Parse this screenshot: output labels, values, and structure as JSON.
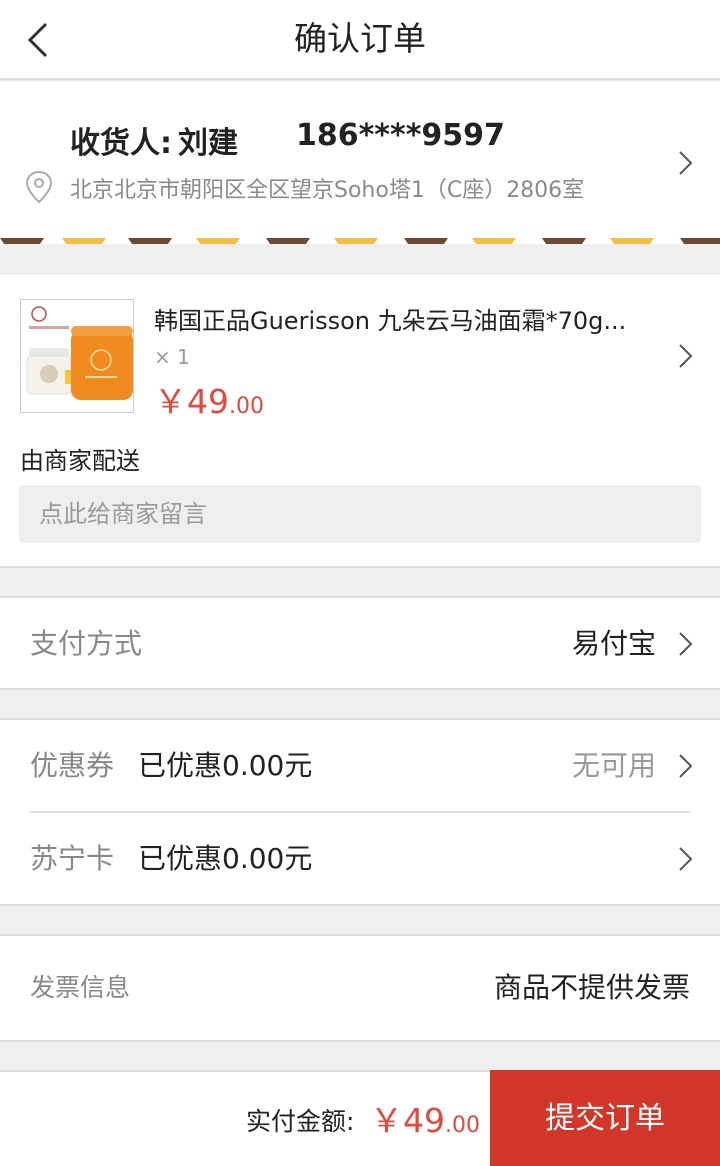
{
  "nav": {
    "title": "确认订单"
  },
  "address": {
    "recipient_label": "收货人:",
    "recipient_name": "刘建",
    "phone": "186****9597",
    "full_address": "北京北京市朝阳区全区望京Soho塔1（C座）2806室"
  },
  "product": {
    "name": "韩国正品Guerisson 九朵云马油面霜*70g...",
    "quantity": "× 1",
    "price_symbol": "￥",
    "price_int": "49",
    "price_dec": ".00",
    "delivery": "由商家配送",
    "message_placeholder": "点此给商家留言"
  },
  "payment": {
    "label": "支付方式",
    "value": "易付宝"
  },
  "coupon": {
    "label": "优惠券",
    "discount": "已优惠0.00元",
    "value": "无可用"
  },
  "card": {
    "label": "苏宁卡",
    "discount": "已优惠0.00元"
  },
  "invoice": {
    "label": "发票信息",
    "value": "商品不提供发票"
  },
  "footer": {
    "total_label": "实付金额:",
    "price_symbol": "￥",
    "price_int": "49",
    "price_dec": ".00",
    "submit_label": "提交订单"
  },
  "colors": {
    "accent": "#e2483e",
    "submit": "#d23628",
    "stripe_brown": "#6b4a38",
    "stripe_yellow": "#f5c042"
  }
}
